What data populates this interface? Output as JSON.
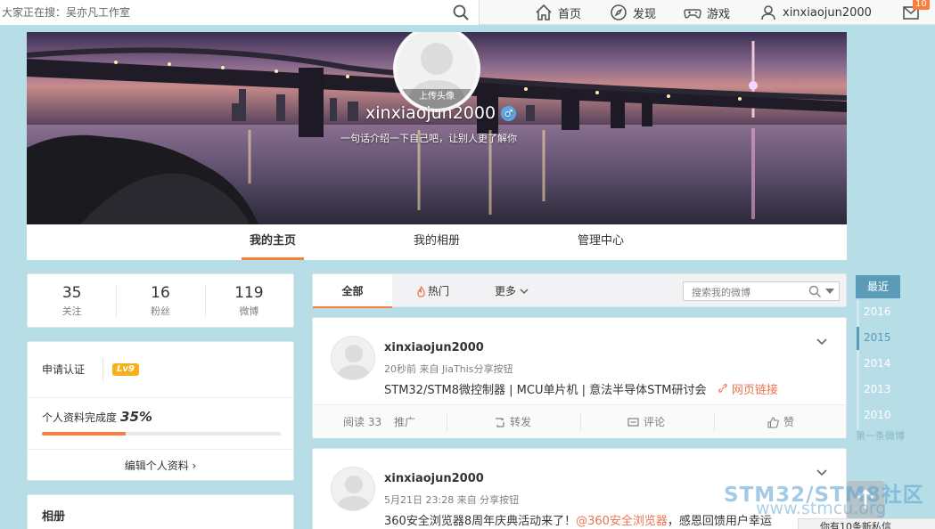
{
  "topbar": {
    "search_placeholder": "大家正在搜：吴亦凡工作室",
    "nav": [
      {
        "label": "首页"
      },
      {
        "label": "发现"
      },
      {
        "label": "游戏"
      },
      {
        "label": "xinxiaojun2000"
      }
    ],
    "message_count": "10"
  },
  "banner": {
    "upload_label": "上传头像",
    "username": "xinxiaojun2000",
    "gender_symbol": "♂",
    "intro": "一句话介绍一下自己吧，让别人更了解你"
  },
  "tabs": [
    {
      "label": "我的主页",
      "active": true
    },
    {
      "label": "我的相册",
      "active": false
    },
    {
      "label": "管理中心",
      "active": false
    }
  ],
  "stats": [
    {
      "num": "35",
      "label": "关注"
    },
    {
      "num": "16",
      "label": "粉丝"
    },
    {
      "num": "119",
      "label": "微博"
    }
  ],
  "verify": {
    "apply_label": "申请认证",
    "level": "Lv9",
    "completion_label": "个人资料完成度",
    "completion_value": "35%",
    "completion": 0.35,
    "edit_label": "编辑个人资料 ›"
  },
  "album": {
    "title": "相册"
  },
  "filter": {
    "all_label": "全部",
    "hot_label": "热门",
    "more_label": "更多",
    "search_placeholder": "搜索我的微博"
  },
  "posts": [
    {
      "name": "xinxiaojun2000",
      "meta": "20秒前 来自 JiaThis分享按钮",
      "text": "STM32/STM8微控制器 | MCU单片机 | 意法半导体STM研讨会",
      "link": "网页链接",
      "actions": {
        "read": "阅读 33",
        "promote": "推广",
        "repost": "转发",
        "comment": "评论",
        "like": "赞"
      }
    },
    {
      "name": "xinxiaojun2000",
      "meta": "5月21日 23:28 来自 分享按钮",
      "text_prefix": "360安全浏览器8周年庆典活动来了！",
      "mention": "@360安全浏览器",
      "text_suffix": "，感恩回馈用户幸运"
    }
  ],
  "timeline": {
    "now": "最近",
    "years": [
      "2016",
      "2015",
      "2014",
      "2013",
      "2010"
    ],
    "first": "第一条微博"
  },
  "watermark": {
    "line1": "STM32/STM8社区",
    "line2": "www.stmcu.org"
  },
  "bottom_tip": "你有10条新私信"
}
